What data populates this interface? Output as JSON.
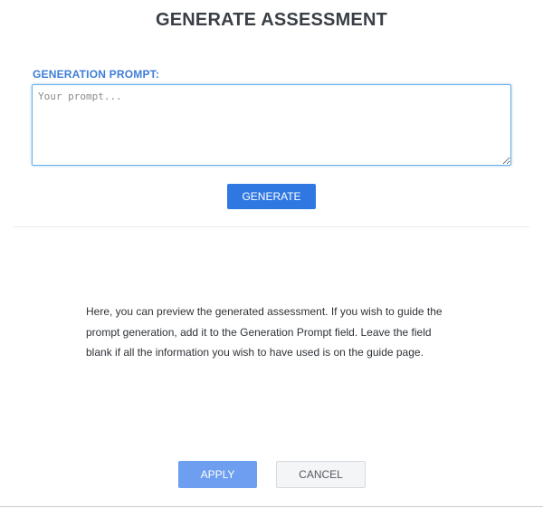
{
  "dialog": {
    "title": "GENERATE ASSESSMENT"
  },
  "prompt": {
    "label": "GENERATION PROMPT:",
    "placeholder": "Your prompt...",
    "value": ""
  },
  "actions": {
    "generate_label": "GENERATE",
    "apply_label": "APPLY",
    "cancel_label": "CANCEL"
  },
  "preview": {
    "text": "Here, you can preview the generated assessment. If you wish to guide the prompt generation, add it to the Generation Prompt field. Leave the field blank if all the information you wish to have used is on the guide page."
  },
  "colors": {
    "accent": "#2f78e2",
    "label": "#3d7dd6",
    "apply_disabled": "#6d9ef0"
  }
}
